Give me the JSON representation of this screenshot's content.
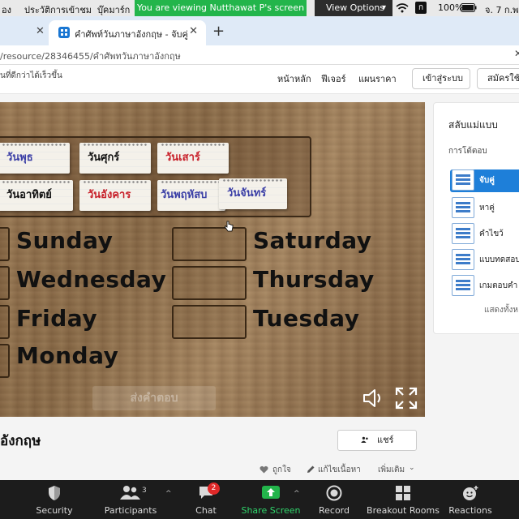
{
  "menubar": {
    "items": [
      "อง",
      "ประวัติการเข้าชม",
      "บุ๊คมาร์ก"
    ],
    "share_banner": "You are viewing Nutthawat P's screen",
    "view_options": "View Options",
    "battery": "100%",
    "date": "จ. 7 ก.พ."
  },
  "browser": {
    "tab_title": "คำศัพท์วันภาษาอังกฤษ - จับคู่",
    "url": "/resource/28346455/คำศัพทวันภาษาอังกฤษ"
  },
  "site": {
    "tagline": "นที่ดีกว่าได้เร็วขึ้น",
    "nav": [
      "หน้าหลัก",
      "ฟีเจอร์",
      "แผนราคา"
    ],
    "login": "เข้าสู่ระบบ",
    "signup": "สมัครใช้"
  },
  "game": {
    "cards": [
      {
        "text": "วันพุธ",
        "color": "#3b3fa6"
      },
      {
        "text": "วันศุกร์",
        "color": "#111111"
      },
      {
        "text": "วันเสาร์",
        "color": "#c8202a"
      },
      {
        "text": "วันอาทิตย์",
        "color": "#111111"
      },
      {
        "text": "วันอังคาร",
        "color": "#c8202a"
      },
      {
        "text": "วันพฤหัสบ",
        "color": "#3b3fa6"
      },
      {
        "text": "วันจันทร์",
        "color": "#3b3fa6"
      }
    ],
    "words": [
      "Sunday",
      "Wednesday",
      "Friday",
      "Monday",
      "Saturday",
      "Thursday",
      "Tuesday"
    ],
    "submit": "ส่งคำตอบ"
  },
  "panel": {
    "title": "สลับแม่แบบ",
    "subtitle": "การโต้ตอบ",
    "templates": [
      "จับคู่",
      "หาคู่",
      "คำไขว้",
      "แบบทดสอบ",
      "เกมตอบคำ"
    ],
    "more": "แสดงทั้งห"
  },
  "below": {
    "title": "อังกฤษ",
    "share": "แชร์",
    "like": "ถูกใจ",
    "edit": "แก้ไขเนื้อหา",
    "more": "เพิ่มเติม"
  },
  "zoom": {
    "security": "Security",
    "participants": "Participants",
    "participants_count": "3",
    "chat": "Chat",
    "chat_badge": "2",
    "share_screen": "Share Screen",
    "record": "Record",
    "breakout": "Breakout Rooms",
    "reactions": "Reactions"
  }
}
